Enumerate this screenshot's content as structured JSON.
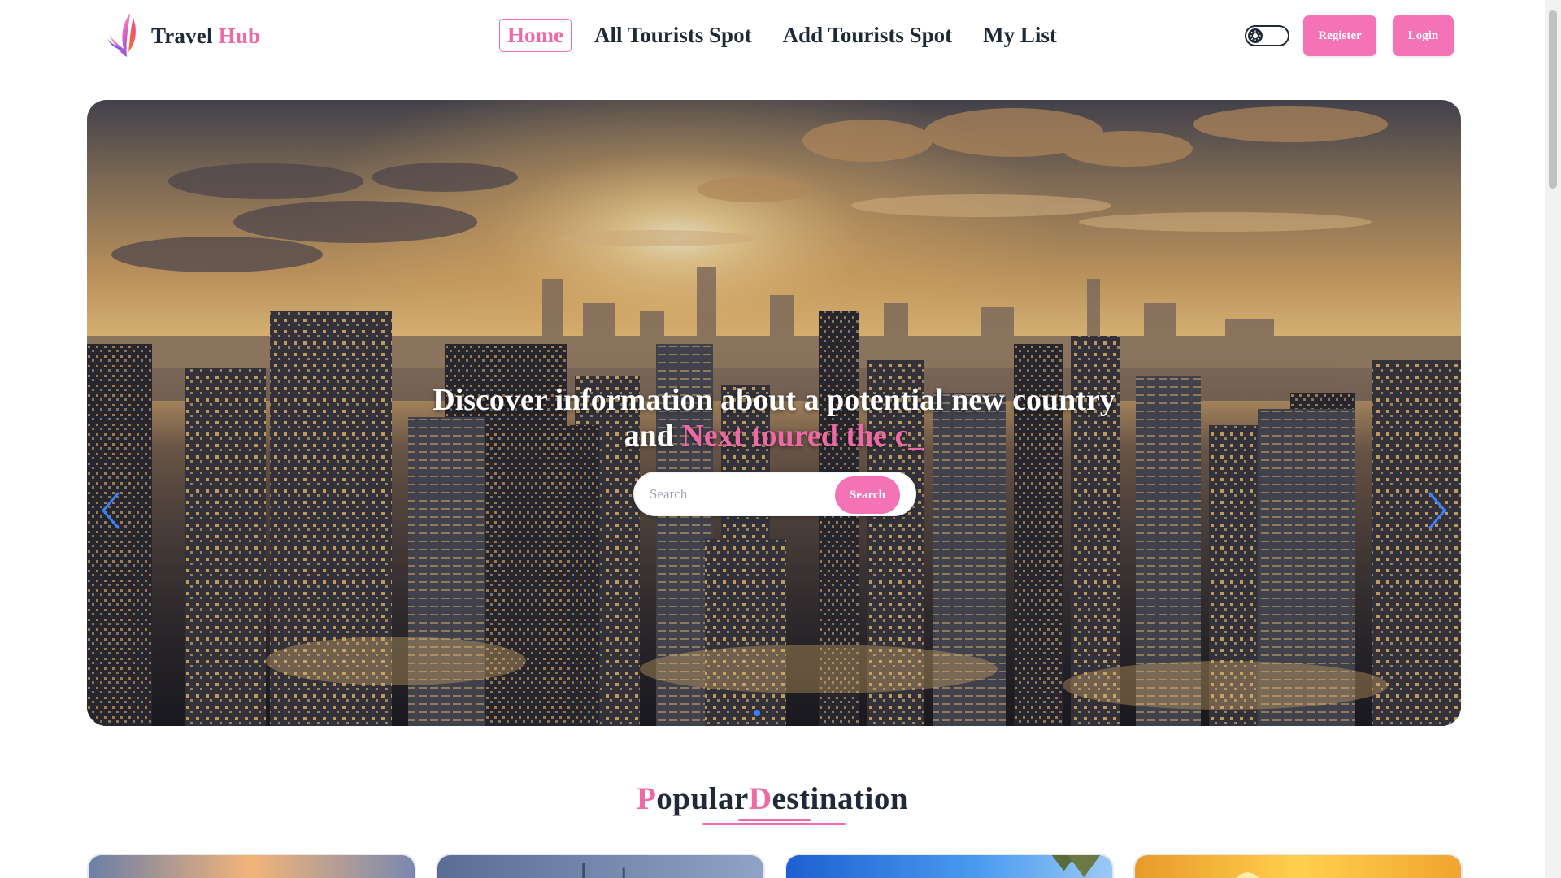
{
  "brand": {
    "name_part1": "Travel",
    "name_part2": "Hub"
  },
  "nav": {
    "links": [
      {
        "label": "Home",
        "active": true
      },
      {
        "label": "All Tourists Spot",
        "active": false
      },
      {
        "label": "Add Tourists Spot",
        "active": false
      },
      {
        "label": "My List",
        "active": false
      }
    ],
    "register_label": "Register",
    "login_label": "Login"
  },
  "hero": {
    "headline_line1": "Discover information about a potential new country",
    "headline_line2_prefix": "and",
    "typed_text": "Next toured the c",
    "typed_cursor": "_",
    "search_placeholder": "Search",
    "search_button": "Search",
    "slide_count": 1,
    "active_slide": 0
  },
  "popular": {
    "title_cap1": "P",
    "title_rest1": "opular",
    "title_cap2": "D",
    "title_rest2": "estination"
  },
  "colors": {
    "accent": "#ee6aa7",
    "button": "#f472b6",
    "text": "#1f2937",
    "carousel_arrow": "#3b82f6"
  },
  "icons": {
    "logo": "bird-logo-icon",
    "theme": "sun-icon",
    "prev": "chevron-left-icon",
    "next": "chevron-right-icon"
  }
}
